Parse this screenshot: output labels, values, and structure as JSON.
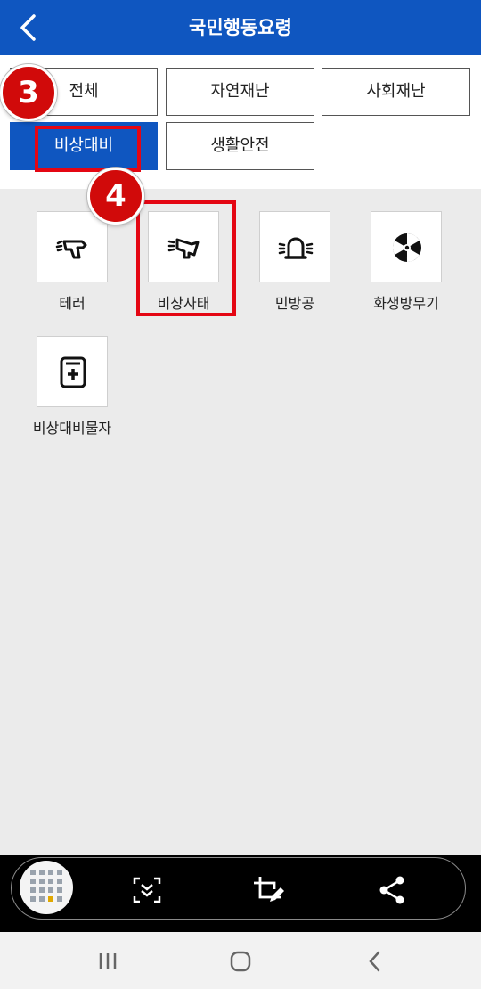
{
  "app": {
    "title": "국민행동요령"
  },
  "tabs": [
    {
      "label": "전체",
      "active": false
    },
    {
      "label": "자연재난",
      "active": false
    },
    {
      "label": "사회재난",
      "active": false
    },
    {
      "label": "비상대비",
      "active": true
    },
    {
      "label": "생활안전",
      "active": false
    }
  ],
  "markers": [
    "3",
    "4"
  ],
  "items": [
    {
      "label": "테러",
      "icon": "gun-icon"
    },
    {
      "label": "비상사태",
      "icon": "megaphone-icon"
    },
    {
      "label": "민방공",
      "icon": "siren-icon"
    },
    {
      "label": "화생방무기",
      "icon": "radiation-icon"
    },
    {
      "label": "비상대비물자",
      "icon": "emergency-supplies-icon"
    }
  ],
  "toolbar": {
    "icons": [
      "screenshot-thumbnail",
      "scroll-capture-icon",
      "crop-edit-icon",
      "share-icon"
    ]
  },
  "navbar": {
    "icons": [
      "recent-apps-icon",
      "home-icon",
      "back-icon"
    ]
  },
  "colors": {
    "primary": "#0f56c0",
    "highlight": "#e40613",
    "marker": "#d10a0a",
    "background": "#ebebeb"
  }
}
